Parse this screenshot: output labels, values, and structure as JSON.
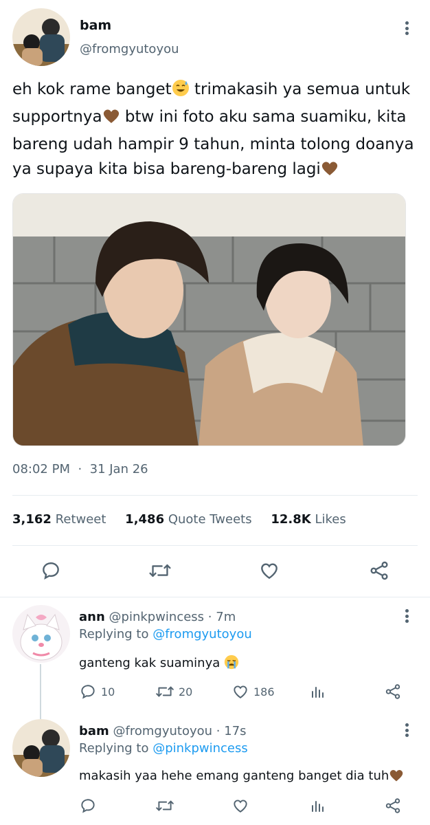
{
  "tweet": {
    "author_name": "bam",
    "author_handle": "@fromgyutoyou",
    "text_parts": [
      "eh kok rame banget",
      " trimakasih ya semua untuk supportnya",
      " btw ini foto aku sama suamiku, kita bareng udah hampir 9 tahun, minta tolong doanya ya supaya kita bisa bareng-bareng lagi"
    ],
    "time": "08:02 PM",
    "dot": "·",
    "date": "31 Jan 26",
    "retweets_count": "3,162",
    "retweets_label": "Retweet",
    "quotes_count": "1,486",
    "quotes_label": "Quote Tweets",
    "likes_count": "12.8K",
    "likes_label": "Likes"
  },
  "replies": [
    {
      "name": "ann",
      "handle": "@pinkpwincess",
      "sep": "·",
      "time": "7m",
      "replying_label": "Replying to",
      "replying_to": "@fromgyutoyou",
      "text": "ganteng kak suaminya",
      "reply_count": "10",
      "retweet_count": "20",
      "like_count": "186"
    },
    {
      "name": "bam",
      "handle": "@fromgyutoyou",
      "sep": "·",
      "time": "17s",
      "replying_label": "Replying to",
      "replying_to": "@pinkpwincess",
      "text": "makasih yaa hehe emang ganteng banget dia tuh"
    }
  ],
  "icons": {
    "reply": "reply-icon",
    "retweet": "retweet-icon",
    "like": "heart-icon",
    "share": "share-icon",
    "analytics": "analytics-icon",
    "more": "more-icon"
  },
  "colors": {
    "link": "#1d9bf0",
    "secondary_text": "#536471",
    "primary_text": "#0f1419",
    "divider": "#e6ecf0"
  }
}
